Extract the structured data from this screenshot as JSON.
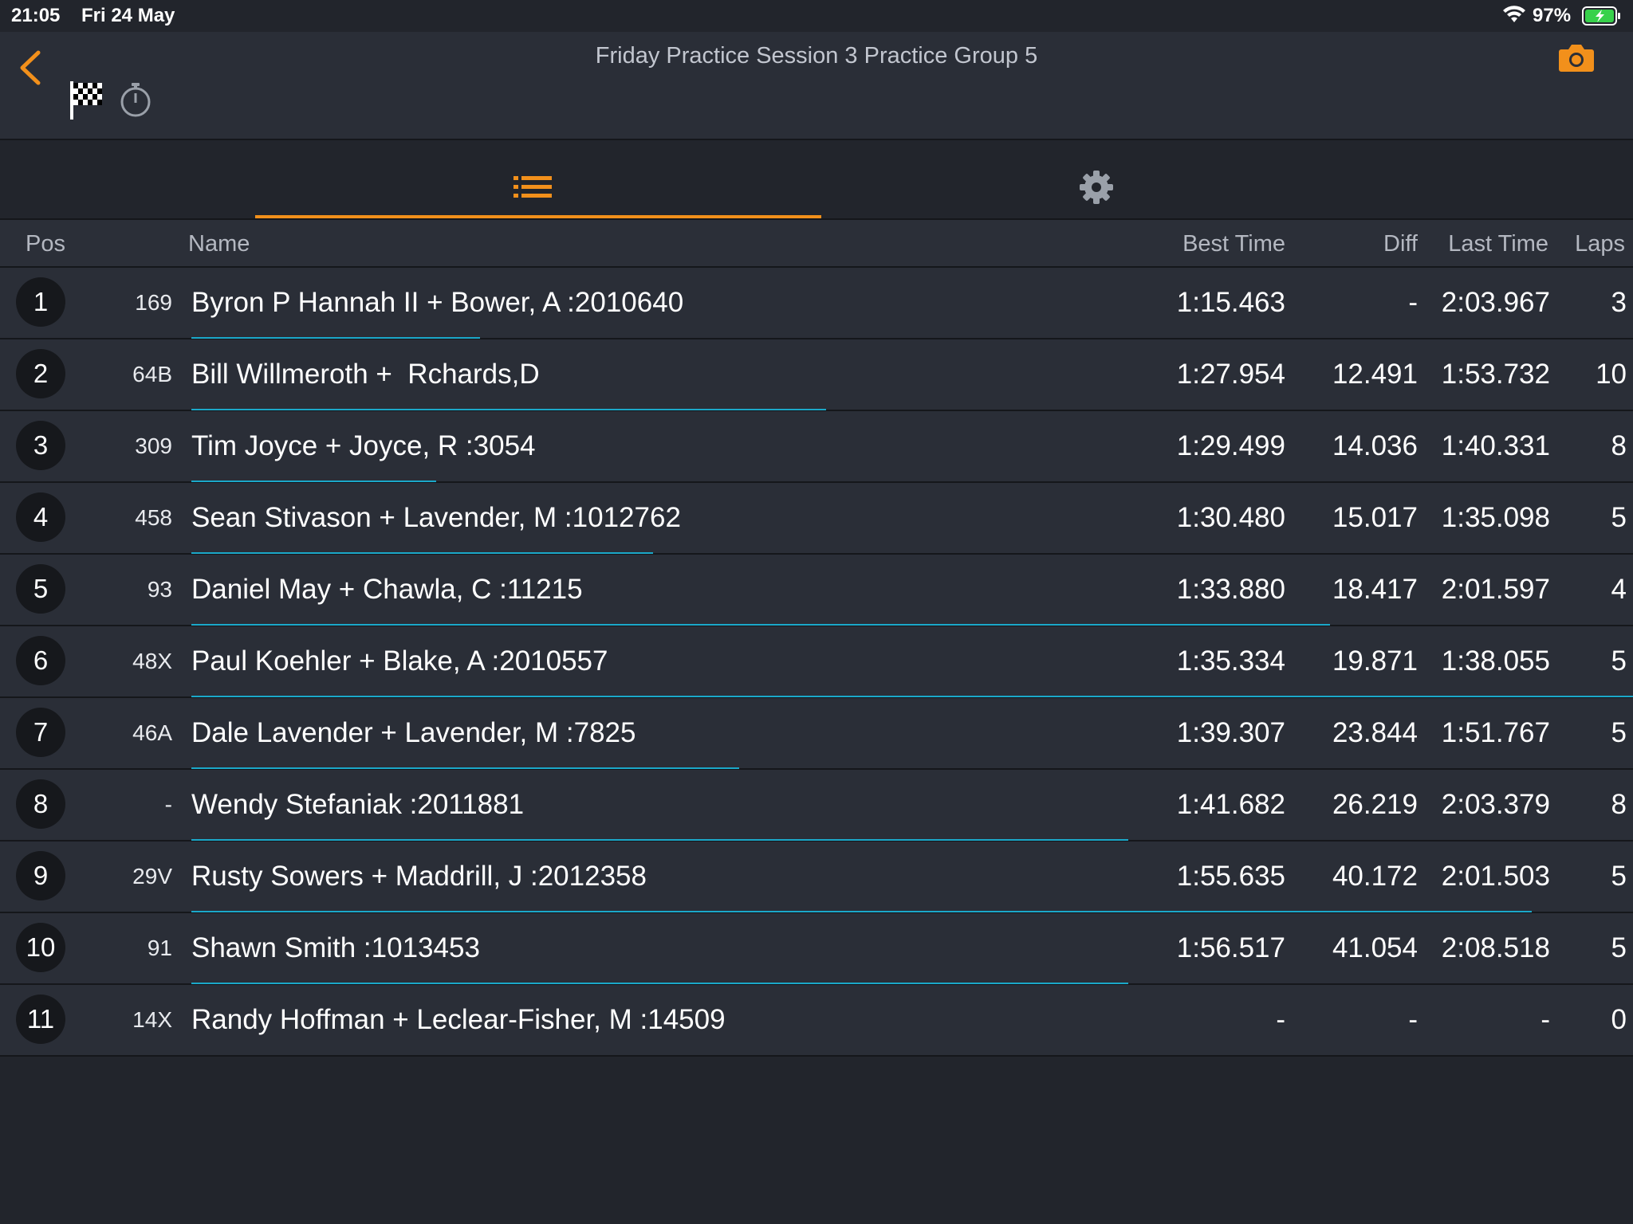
{
  "status_bar": {
    "time": "21:05",
    "date": "Fri 24 May",
    "battery": "97%"
  },
  "header": {
    "title": "Friday Practice Session 3 Practice Group 5"
  },
  "icons": {
    "back": "chevron-left-icon",
    "flag": "checkered-flag-icon",
    "stopwatch": "stopwatch-icon",
    "camera": "camera-icon",
    "list": "list-icon",
    "settings": "gear-icon"
  },
  "colors": {
    "accent": "#f2901b",
    "progress": "#1ba8c9",
    "background": "#22252c",
    "row": "#2a2e37"
  },
  "columns": {
    "pos": "Pos",
    "name": "Name",
    "best": "Best Time",
    "diff": "Diff",
    "last": "Last Time",
    "laps": "Laps"
  },
  "rows": [
    {
      "pos": "1",
      "num": "169",
      "name": "Byron P Hannah II + Bower, A :2010640",
      "best": "1:15.463",
      "diff": "-",
      "last": "2:03.967",
      "laps": "3",
      "progress": 0.2
    },
    {
      "pos": "2",
      "num": "64B",
      "name": "Bill Willmeroth +  Rchards,D",
      "best": "1:27.954",
      "diff": "12.491",
      "last": "1:53.732",
      "laps": "10",
      "progress": 0.44
    },
    {
      "pos": "3",
      "num": "309",
      "name": "Tim Joyce + Joyce, R :3054",
      "best": "1:29.499",
      "diff": "14.036",
      "last": "1:40.331",
      "laps": "8",
      "progress": 0.17
    },
    {
      "pos": "4",
      "num": "458",
      "name": "Sean Stivason + Lavender, M :1012762",
      "best": "1:30.480",
      "diff": "15.017",
      "last": "1:35.098",
      "laps": "5",
      "progress": 0.32
    },
    {
      "pos": "5",
      "num": "93",
      "name": "Daniel May + Chawla, C :11215",
      "best": "1:33.880",
      "diff": "18.417",
      "last": "2:01.597",
      "laps": "4",
      "progress": 0.79
    },
    {
      "pos": "6",
      "num": "48X",
      "name": "Paul Koehler + Blake, A :2010557",
      "best": "1:35.334",
      "diff": "19.871",
      "last": "1:38.055",
      "laps": "5",
      "progress": 1.0
    },
    {
      "pos": "7",
      "num": "46A",
      "name": "Dale Lavender + Lavender, M :7825",
      "best": "1:39.307",
      "diff": "23.844",
      "last": "1:51.767",
      "laps": "5",
      "progress": 0.38
    },
    {
      "pos": "8",
      "num": "-",
      "name": "Wendy Stefaniak :2011881",
      "best": "1:41.682",
      "diff": "26.219",
      "last": "2:03.379",
      "laps": "8",
      "progress": 0.65
    },
    {
      "pos": "9",
      "num": "29V",
      "name": "Rusty Sowers + Maddrill, J :2012358",
      "best": "1:55.635",
      "diff": "40.172",
      "last": "2:01.503",
      "laps": "5",
      "progress": 0.93
    },
    {
      "pos": "10",
      "num": "91",
      "name": "Shawn Smith :1013453",
      "best": "1:56.517",
      "diff": "41.054",
      "last": "2:08.518",
      "laps": "5",
      "progress": 0.65
    },
    {
      "pos": "11",
      "num": "14X",
      "name": "Randy Hoffman + Leclear-Fisher, M :14509",
      "best": "-",
      "diff": "-",
      "last": "-",
      "laps": "0",
      "progress": 0
    }
  ]
}
